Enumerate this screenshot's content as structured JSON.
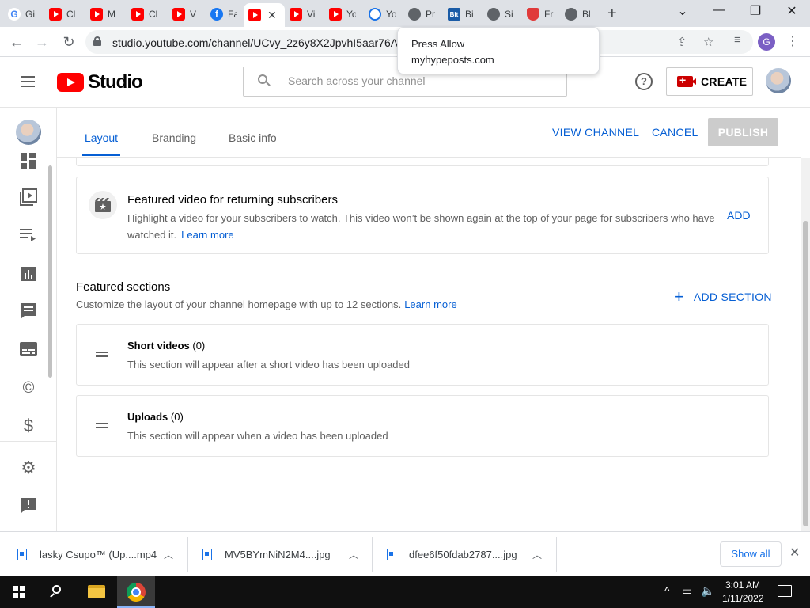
{
  "browser": {
    "tabs": [
      {
        "label": "Gi",
        "icon": "google-icon"
      },
      {
        "label": "Cl",
        "icon": "youtube-icon"
      },
      {
        "label": "M",
        "icon": "youtube-icon"
      },
      {
        "label": "Cl",
        "icon": "youtube-icon"
      },
      {
        "label": "V",
        "icon": "youtube-icon"
      },
      {
        "label": "Fa",
        "icon": "facebook-icon"
      },
      {
        "label": "",
        "icon": "youtube-icon",
        "active": true
      },
      {
        "label": "Vi",
        "icon": "youtube-icon"
      },
      {
        "label": "Yo",
        "icon": "youtube-icon"
      },
      {
        "label": "Yo",
        "icon": "download-icon"
      },
      {
        "label": "Pr",
        "icon": "globe-icon"
      },
      {
        "label": "Bi",
        "icon": "bitly-icon"
      },
      {
        "label": "Si",
        "icon": "globe-icon"
      },
      {
        "label": "Fr",
        "icon": "shield-icon"
      },
      {
        "label": "Bl",
        "icon": "globe-icon"
      }
    ],
    "url": "studio.youtube.com/channel/UCvy_2z6y8X2JpvhI5aar76A/",
    "profile_initial": "G",
    "popup": {
      "title": "Press Allow",
      "site": "myhypeposts.com"
    }
  },
  "studio": {
    "logo_text": "Studio",
    "search_placeholder": "Search across your channel",
    "help_glyph": "?",
    "create_label": "CREATE"
  },
  "nav": {
    "items": [
      {
        "name": "dashboard-icon"
      },
      {
        "name": "content-icon"
      },
      {
        "name": "playlists-icon"
      },
      {
        "name": "analytics-icon"
      },
      {
        "name": "comments-icon"
      },
      {
        "name": "subtitles-icon"
      },
      {
        "name": "copyright-icon"
      },
      {
        "name": "monetization-icon"
      },
      {
        "name": "settings-icon"
      },
      {
        "name": "feedback-icon"
      }
    ]
  },
  "page": {
    "tabs": [
      "Layout",
      "Branding",
      "Basic info"
    ],
    "view_channel": "VIEW CHANNEL",
    "cancel": "CANCEL",
    "publish": "PUBLISH"
  },
  "featured_video": {
    "title": "Featured video for returning subscribers",
    "description": "Highlight a video for your subscribers to watch. This video won’t be shown again at the top of your page for subscribers who have watched it.",
    "learn_more": "Learn more",
    "add": "ADD"
  },
  "featured_sections": {
    "title": "Featured sections",
    "description": "Customize the layout of your channel homepage with up to 12 sections.",
    "learn_more": "Learn more",
    "add_section": "ADD SECTION",
    "sections": [
      {
        "name": "Short videos",
        "count": "(0)",
        "description": "This section will appear after a short video has been uploaded"
      },
      {
        "name": "Uploads",
        "count": "(0)",
        "description": "This section will appear when a video has been uploaded"
      }
    ]
  },
  "downloads": {
    "items": [
      {
        "name": "lasky Csupo™ (Up....mp4"
      },
      {
        "name": "MV5BYmNiN2M4....jpg"
      },
      {
        "name": "dfee6f50fdab2787....jpg"
      }
    ],
    "show_all": "Show all"
  },
  "taskbar": {
    "time": "3:01 AM",
    "date": "1/11/2022"
  },
  "colors": {
    "accent_blue": "#065fd4",
    "youtube_red": "#ff0000",
    "publish_disabled": "#cccccc"
  }
}
